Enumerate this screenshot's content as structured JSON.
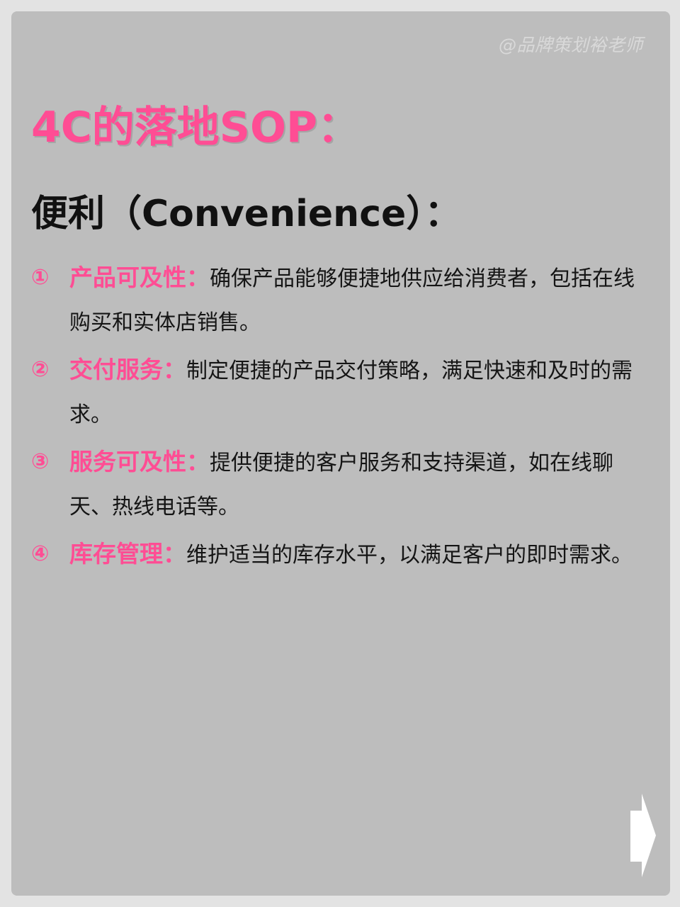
{
  "watermark": "@品牌策划裕老师",
  "title": "4C的落地SOP：",
  "subtitle": "便利（Convenience）：",
  "items": [
    {
      "num": "①",
      "label": "产品可及性：",
      "text": "确保产品能够便捷地供应给消费者，包括在线购买和实体店销售。"
    },
    {
      "num": "②",
      "label": "交付服务：",
      "text": "制定便捷的产品交付策略，满足快速和及时的需求。"
    },
    {
      "num": "③",
      "label": "服务可及性：",
      "text": "提供便捷的客户服务和支持渠道，如在线聊天、热线电话等。"
    },
    {
      "num": "④",
      "label": "库存管理：",
      "text": "维护适当的库存水平，以满足客户的即时需求。"
    }
  ],
  "next_icon": "arrow-right-icon",
  "colors": {
    "accent": "#ff4d94",
    "card_bg": "#bdbdbd",
    "page_bg": "#e3e3e3",
    "text": "#151515"
  }
}
